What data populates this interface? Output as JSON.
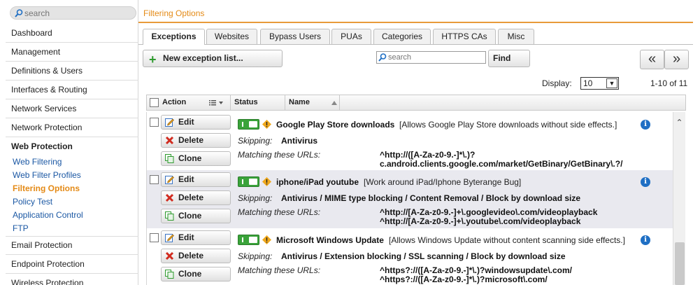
{
  "sidebar": {
    "search_placeholder": "search",
    "items": [
      {
        "label": "Dashboard"
      },
      {
        "label": "Management"
      },
      {
        "label": "Definitions & Users"
      },
      {
        "label": "Interfaces & Routing"
      },
      {
        "label": "Network Services"
      },
      {
        "label": "Network Protection"
      },
      {
        "label": "Web Protection"
      },
      {
        "label": "Email Protection"
      },
      {
        "label": "Endpoint Protection"
      },
      {
        "label": "Wireless Protection"
      }
    ],
    "subitems": [
      {
        "label": "Web Filtering"
      },
      {
        "label": "Web Filter Profiles"
      },
      {
        "label": "Filtering Options",
        "active": true
      },
      {
        "label": "Policy Test"
      },
      {
        "label": "Application Control"
      },
      {
        "label": "FTP"
      }
    ]
  },
  "header": {
    "title": "Filtering Options"
  },
  "tabs": [
    {
      "label": "Exceptions",
      "active": true
    },
    {
      "label": "Websites"
    },
    {
      "label": "Bypass Users"
    },
    {
      "label": "PUAs"
    },
    {
      "label": "Categories"
    },
    {
      "label": "HTTPS CAs"
    },
    {
      "label": "Misc"
    }
  ],
  "toolbar": {
    "new_label": "New exception list...",
    "search_placeholder": "search",
    "find_label": "Find",
    "prev_label": "«",
    "next_label": "»",
    "display_label": "Display:",
    "display_value": "10",
    "page_info": "1-10 of 11"
  },
  "table": {
    "headers": {
      "action": "Action",
      "status": "Status",
      "name": "Name"
    },
    "buttons": {
      "edit": "Edit",
      "delete": "Delete",
      "clone": "Clone"
    },
    "skipping_label": "Skipping:",
    "matching_label": "Matching these URLs:",
    "rows": [
      {
        "name": "Google Play Store downloads",
        "desc": "[Allows Google Play Store downloads without side effects.]",
        "skipping": "Antivirus",
        "urls": [
          "^http://([A-Za-z0-9.-]*\\.)?",
          "c.android.clients.google.com/market/GetBinary/GetBinary\\.?/"
        ]
      },
      {
        "name": "iphone/iPad youtube",
        "desc": "[Work around iPad/Iphone Byterange Bug]",
        "skipping": "Antivirus / MIME type blocking / Content Removal / Block by download size",
        "urls": [
          "^http://[A-Za-z0-9.-]+\\.googlevideo\\.com/videoplayback",
          "^http://[A-Za-z0-9.-]+\\.youtube\\.com/videoplayback"
        ]
      },
      {
        "name": "Microsoft Windows Update",
        "desc": "[Allows Windows Update without content scanning side effects.]",
        "skipping": "Antivirus / Extension blocking / SSL scanning / Block by download size",
        "urls": [
          "^https?://([A-Za-z0-9.-]*\\.)?windowsupdate\\.com/",
          "^https?://([A-Za-z0-9.-]*\\.)?microsoft\\.com/"
        ]
      }
    ]
  },
  "colors": {
    "accent": "#e48a16",
    "link": "#1a57a3",
    "toggle_on": "#3aa33a",
    "info": "#1f6fc4"
  }
}
